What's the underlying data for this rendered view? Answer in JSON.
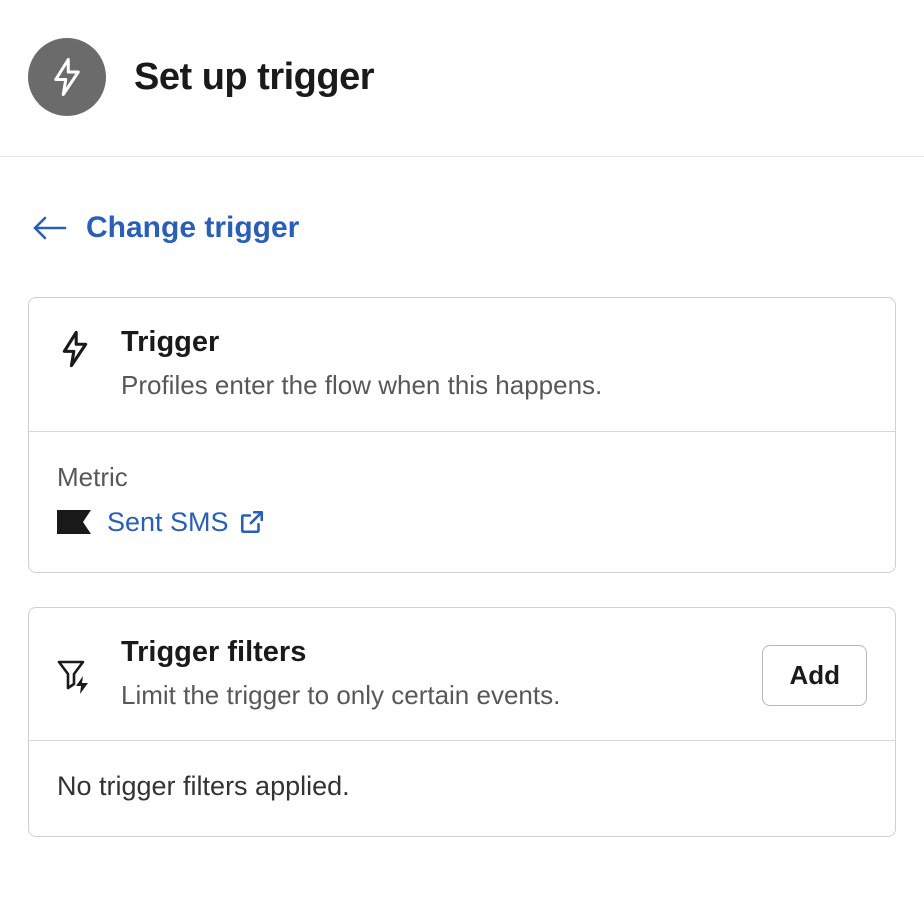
{
  "header": {
    "title": "Set up trigger"
  },
  "changeTrigger": {
    "label": "Change trigger"
  },
  "triggerCard": {
    "title": "Trigger",
    "subtitle": "Profiles enter the flow when this happens.",
    "metricLabel": "Metric",
    "metricName": "Sent SMS"
  },
  "filtersCard": {
    "title": "Trigger filters",
    "subtitle": "Limit the trigger to only certain events.",
    "addLabel": "Add",
    "emptyText": "No trigger filters applied."
  }
}
